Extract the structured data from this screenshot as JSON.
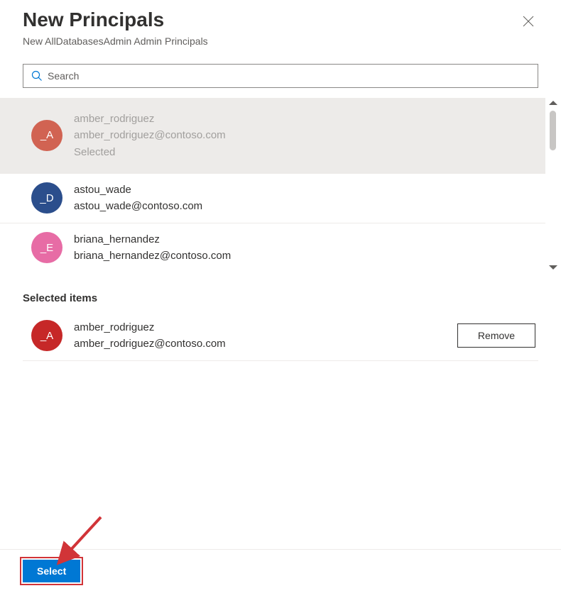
{
  "header": {
    "title": "New Principals",
    "subtitle": "New AllDatabasesAdmin Admin Principals"
  },
  "search": {
    "placeholder": "Search",
    "value": ""
  },
  "people": [
    {
      "badge": "_A",
      "color": "#d16352",
      "name": "amber_rodriguez",
      "email": "amber_rodriguez@contoso.com",
      "status": "Selected",
      "selected": true
    },
    {
      "badge": "_D",
      "color": "#2b4e8c",
      "name": "astou_wade",
      "email": "astou_wade@contoso.com"
    },
    {
      "badge": "_E",
      "color": "#e76ca5",
      "name": "briana_hernandez",
      "email": "briana_hernandez@contoso.com"
    }
  ],
  "selected_section": {
    "heading": "Selected items",
    "items": [
      {
        "badge": "_A",
        "color": "#c62828",
        "name": "amber_rodriguez",
        "email": "amber_rodriguez@contoso.com"
      }
    ],
    "remove_label": "Remove"
  },
  "footer": {
    "select_label": "Select"
  }
}
